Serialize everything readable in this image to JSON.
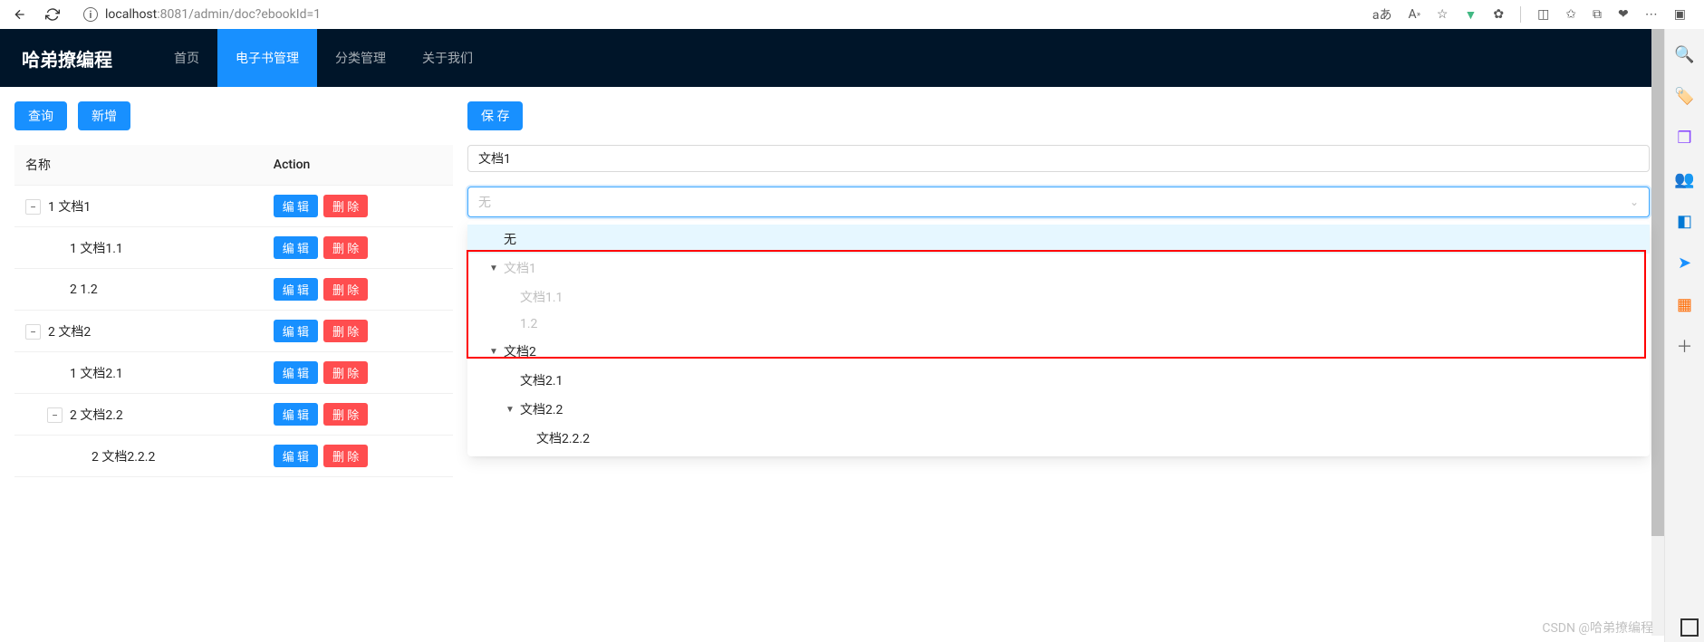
{
  "browser": {
    "url_prefix": "localhost",
    "url_suffix": ":8081/admin/doc?ebookId=1",
    "lang_label": "aあ"
  },
  "header": {
    "logo": "哈弟撩编程",
    "nav": [
      {
        "label": "首页",
        "active": false
      },
      {
        "label": "电子书管理",
        "active": true
      },
      {
        "label": "分类管理",
        "active": false
      },
      {
        "label": "关于我们",
        "active": false
      }
    ]
  },
  "left": {
    "query_label": "查询",
    "add_label": "新增",
    "columns": {
      "name": "名称",
      "action": "Action"
    },
    "edit_label": "编 辑",
    "delete_label": "删 除",
    "rows": [
      {
        "indent": 0,
        "hasToggle": true,
        "seq": "1",
        "name": "文档1"
      },
      {
        "indent": 1,
        "hasToggle": false,
        "seq": "1",
        "name": "文档1.1"
      },
      {
        "indent": 1,
        "hasToggle": false,
        "seq": "2",
        "name": "1.2"
      },
      {
        "indent": 0,
        "hasToggle": true,
        "seq": "2",
        "name": "文档2"
      },
      {
        "indent": 1,
        "hasToggle": false,
        "seq": "1",
        "name": "文档2.1"
      },
      {
        "indent": 1,
        "hasToggle": true,
        "seq": "2",
        "name": "文档2.2"
      },
      {
        "indent": 2,
        "hasToggle": false,
        "seq": "2",
        "name": "文档2.2.2"
      }
    ]
  },
  "right": {
    "save_label": "保 存",
    "doc_name": "文档1",
    "select_placeholder": "无",
    "options": [
      {
        "indent": 0,
        "label": "无",
        "toggle": "",
        "selected": true
      },
      {
        "indent": 0,
        "label": "文档1",
        "toggle": "▼",
        "disabled": true
      },
      {
        "indent": 1,
        "label": "文档1.1",
        "toggle": "",
        "disabled": true
      },
      {
        "indent": 1,
        "label": "1.2",
        "toggle": "",
        "disabled": true
      },
      {
        "indent": 0,
        "label": "文档2",
        "toggle": "▼"
      },
      {
        "indent": 1,
        "label": "文档2.1",
        "toggle": ""
      },
      {
        "indent": 1,
        "label": "文档2.2",
        "toggle": "▼"
      },
      {
        "indent": 2,
        "label": "文档2.2.2",
        "toggle": ""
      }
    ]
  },
  "watermark": "CSDN @哈弟撩编程",
  "sidebar_icons": [
    {
      "name": "search-icon",
      "glyph": "🔍",
      "color": "#666"
    },
    {
      "name": "tag-icon",
      "glyph": "🏷️",
      "color": "#1890ff"
    },
    {
      "name": "cube-icon",
      "glyph": "❒",
      "color": "#8c4dff"
    },
    {
      "name": "people-icon",
      "glyph": "👥",
      "color": "#d46b9e"
    },
    {
      "name": "outlook-icon",
      "glyph": "◧",
      "color": "#0078d4"
    },
    {
      "name": "send-icon",
      "glyph": "➤",
      "color": "#1890ff"
    },
    {
      "name": "video-icon",
      "glyph": "▦",
      "color": "#ff6a00"
    },
    {
      "name": "plus-icon",
      "glyph": "＋",
      "color": "#666"
    }
  ]
}
